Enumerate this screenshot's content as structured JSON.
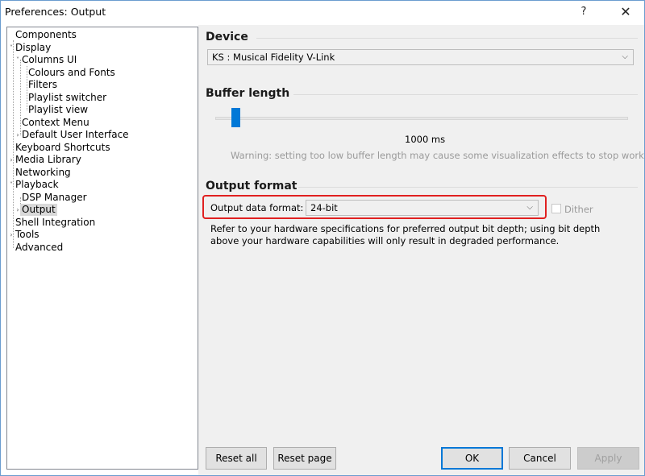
{
  "window": {
    "title": "Preferences: Output",
    "help_glyph": "?",
    "close_glyph": "✕"
  },
  "tree": {
    "items": [
      {
        "label": "Components",
        "level": 0,
        "expander": ""
      },
      {
        "label": "Display",
        "level": 0,
        "expander": "˅"
      },
      {
        "label": "Columns UI",
        "level": 1,
        "expander": "˅"
      },
      {
        "label": "Colours and Fonts",
        "level": 2,
        "expander": ""
      },
      {
        "label": "Filters",
        "level": 2,
        "expander": ""
      },
      {
        "label": "Playlist switcher",
        "level": 2,
        "expander": ""
      },
      {
        "label": "Playlist view",
        "level": 2,
        "expander": ""
      },
      {
        "label": "Context Menu",
        "level": 1,
        "expander": ""
      },
      {
        "label": "Default User Interface",
        "level": 1,
        "expander": "›"
      },
      {
        "label": "Keyboard Shortcuts",
        "level": 0,
        "expander": ""
      },
      {
        "label": "Media Library",
        "level": 0,
        "expander": "›"
      },
      {
        "label": "Networking",
        "level": 0,
        "expander": ""
      },
      {
        "label": "Playback",
        "level": 0,
        "expander": "˅"
      },
      {
        "label": "DSP Manager",
        "level": 1,
        "expander": ""
      },
      {
        "label": "Output",
        "level": 1,
        "expander": "›",
        "selected": true
      },
      {
        "label": "Shell Integration",
        "level": 0,
        "expander": ""
      },
      {
        "label": "Tools",
        "level": 0,
        "expander": "›"
      },
      {
        "label": "Advanced",
        "level": 0,
        "expander": ""
      }
    ]
  },
  "device": {
    "heading": "Device",
    "selected": "KS : Musical Fidelity V-Link"
  },
  "buffer": {
    "heading": "Buffer length",
    "value_text": "1000 ms",
    "slider_fraction": 0.04,
    "warning": "Warning: setting too low buffer length may cause some visualization effects to stop working."
  },
  "output_format": {
    "heading": "Output format",
    "label": "Output data format:",
    "selected": "24-bit",
    "dither_label": "Dither",
    "dither_checked": false,
    "description": "Refer to your hardware specifications for preferred output bit depth; using bit depth above your hardware capabilities will only result in degraded performance."
  },
  "buttons": {
    "reset_all": "Reset all",
    "reset_page": "Reset page",
    "ok": "OK",
    "cancel": "Cancel",
    "apply": "Apply"
  },
  "colors": {
    "accent": "#0078d7",
    "highlight_border": "#e02020",
    "panel_bg": "#f0f0f0"
  },
  "icons": {
    "combo_chevron": "⌵"
  }
}
